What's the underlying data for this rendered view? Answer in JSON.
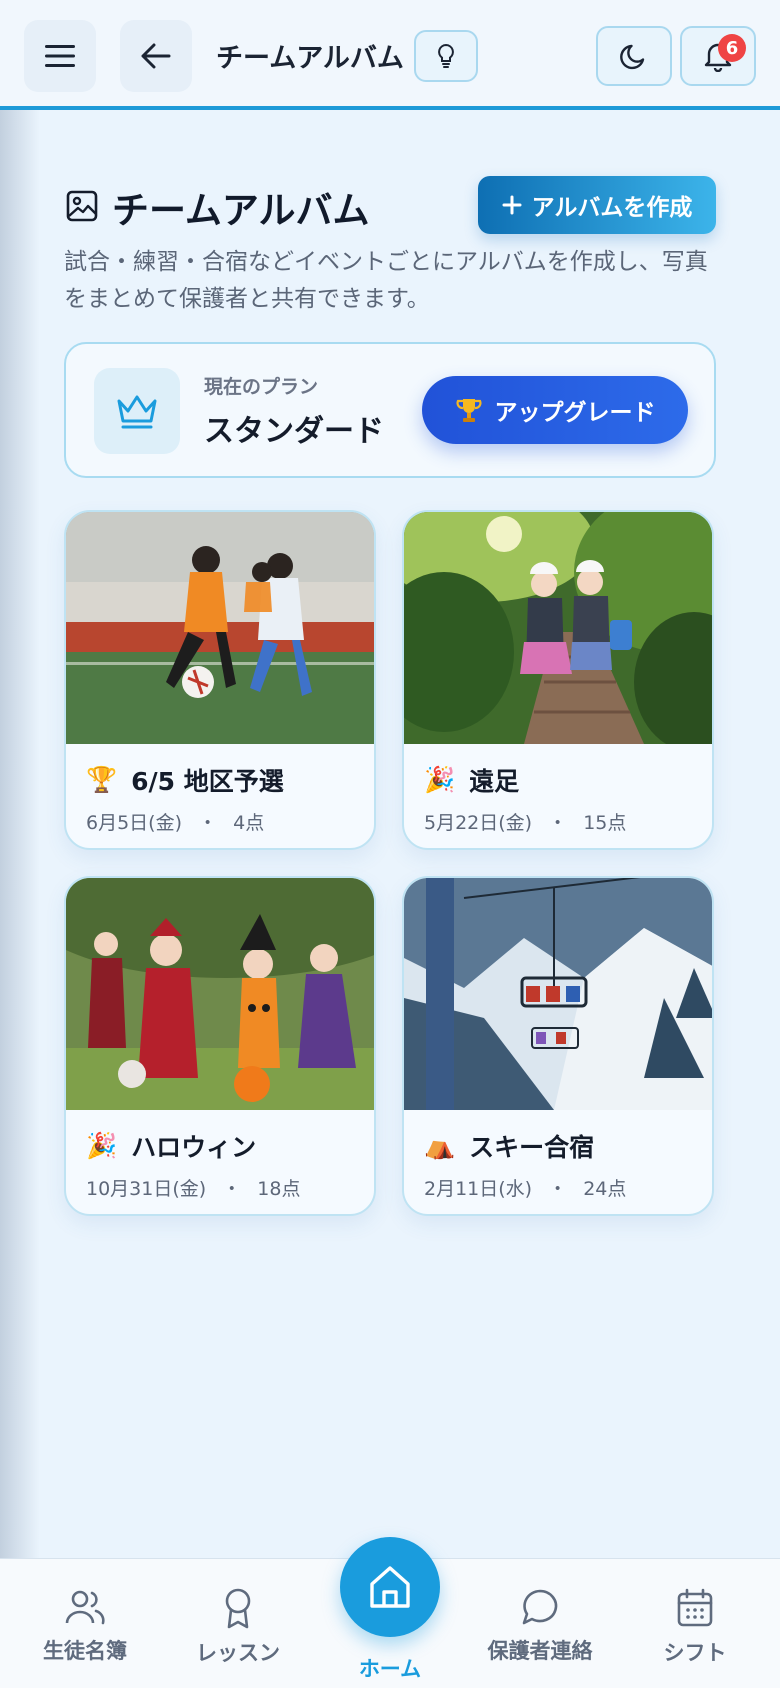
{
  "header": {
    "title": "チームアルバム",
    "notification_count": "6"
  },
  "page": {
    "title": "チームアルバム",
    "create_button": "アルバムを作成",
    "description": "試合・練習・合宿などイベントごとにアルバムを作成し、写真をまとめて保護者と共有できます。"
  },
  "plan": {
    "label": "現在のプラン",
    "name": "スタンダード",
    "upgrade_button": "アップグレード"
  },
  "albums": [
    {
      "emoji": "🏆",
      "title": "6/5 地区予選",
      "date": "6月5日(金)",
      "count": "4点"
    },
    {
      "emoji": "🎉",
      "title": "遠足",
      "date": "5月22日(金)",
      "count": "15点"
    },
    {
      "emoji": "🎉",
      "title": "ハロウィン",
      "date": "10月31日(金)",
      "count": "18点"
    },
    {
      "emoji": "⛺",
      "title": "スキー合宿",
      "date": "2月11日(水)",
      "count": "24点"
    }
  ],
  "meta_separator": "・",
  "nav": {
    "students": "生徒名簿",
    "lessons": "レッスン",
    "home": "ホーム",
    "parents": "保護者連絡",
    "shift": "シフト"
  },
  "colors": {
    "accent": "#1a9cdd",
    "upgrade": "#2152d8",
    "badge": "#ef4444"
  }
}
